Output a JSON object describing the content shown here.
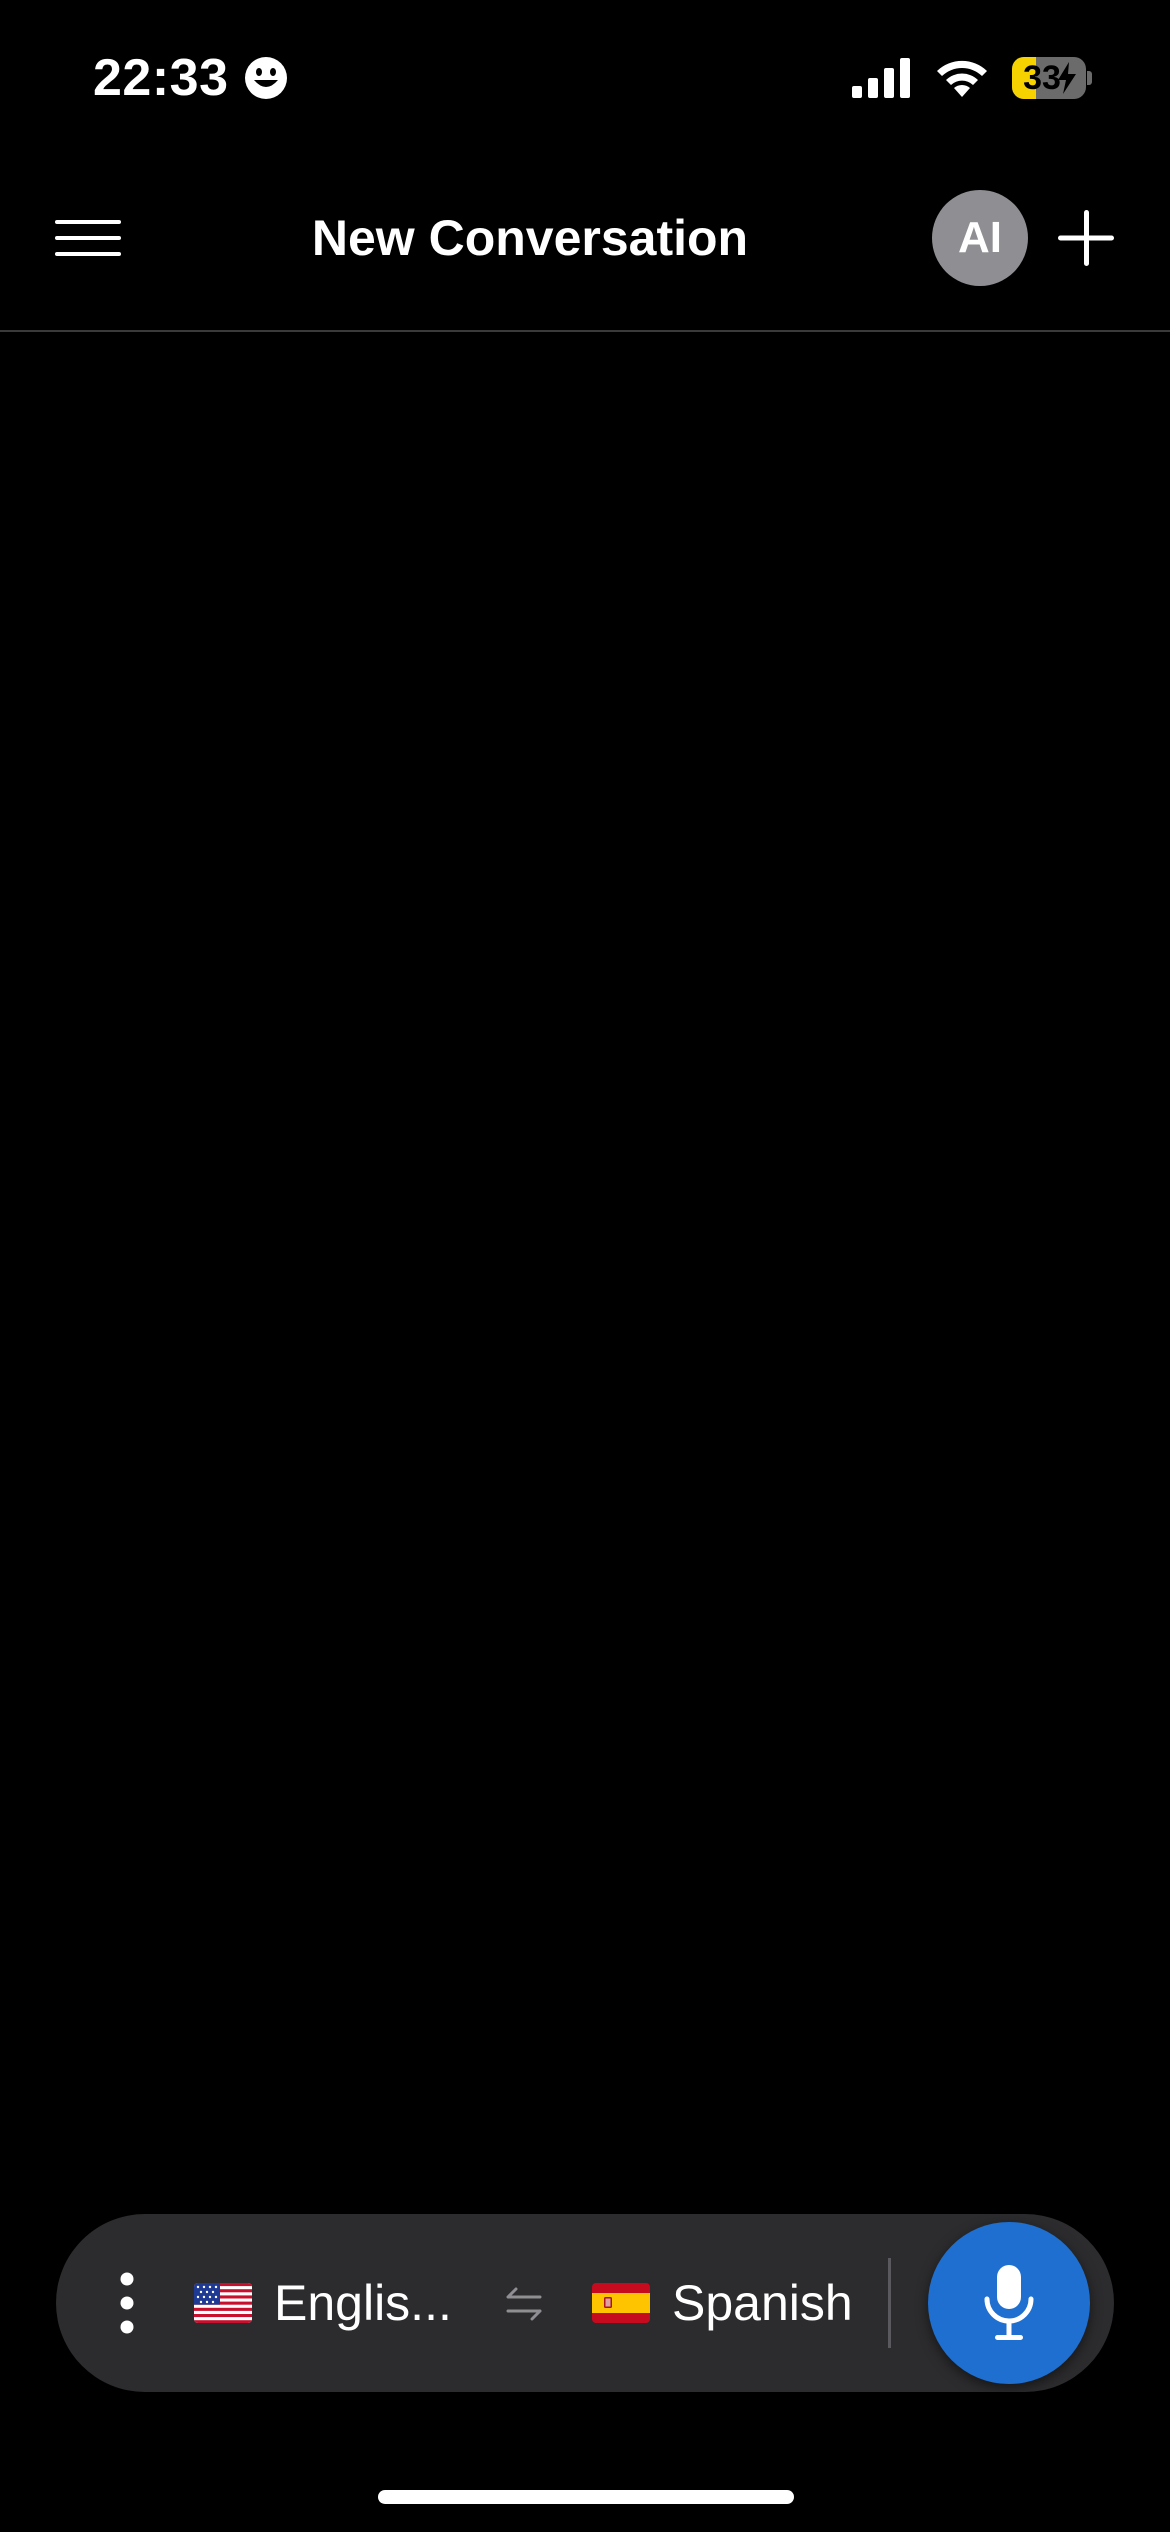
{
  "status_bar": {
    "time": "22:33",
    "battery_level": "33",
    "battery_fraction": 0.33,
    "battery_fill_color": "#f5d200",
    "icons": [
      "smiley-face-icon",
      "cellular-signal-icon",
      "wifi-icon",
      "battery-charging-icon"
    ]
  },
  "header": {
    "title": "New Conversation",
    "avatar_label": "AI",
    "avatar_color": "#8e8e93",
    "icons": [
      "hamburger-menu-icon",
      "plus-icon"
    ]
  },
  "language_bar": {
    "source_language": "Englis...",
    "target_language": "Spanish",
    "source_flag": "us-flag-icon",
    "target_flag": "spain-flag-icon",
    "mic_color": "#1e6fd0",
    "icons": [
      "vertical-dots-icon",
      "swap-arrows-icon",
      "microphone-icon"
    ]
  }
}
